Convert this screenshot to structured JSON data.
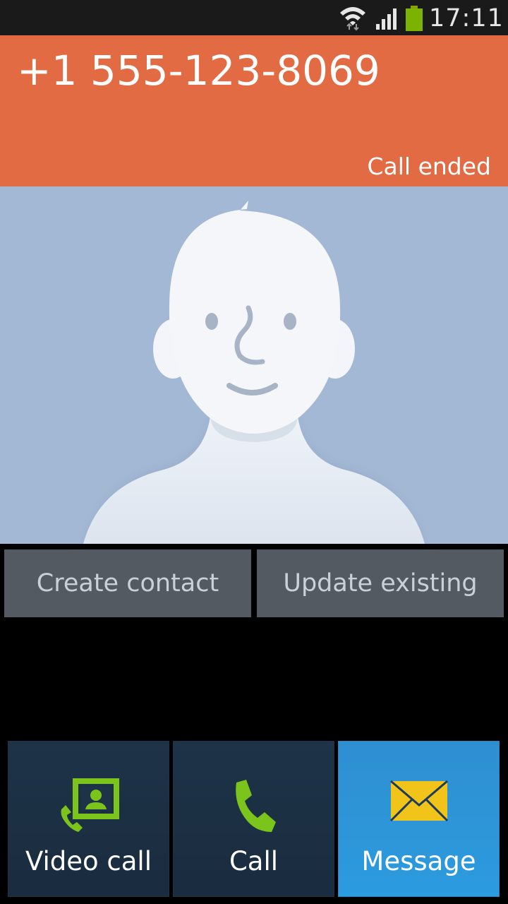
{
  "status_bar": {
    "time": "17:11",
    "icons": [
      "wifi-icon",
      "signal-icon",
      "battery-icon"
    ]
  },
  "call": {
    "number": "+1 555-123-8069",
    "status": "Call ended"
  },
  "contact_actions": {
    "create_label": "Create contact",
    "update_label": "Update existing"
  },
  "bottom_actions": {
    "video_call_label": "Video call",
    "call_label": "Call",
    "message_label": "Message"
  },
  "colors": {
    "header": "#e26b44",
    "photo_bg": "#a3b8d4",
    "button_gray": "#545a61",
    "tile_dark": "#1e3348",
    "tile_active": "#2c9bdf",
    "icon_green": "#7bc41c",
    "envelope_yellow": "#f2c318"
  }
}
